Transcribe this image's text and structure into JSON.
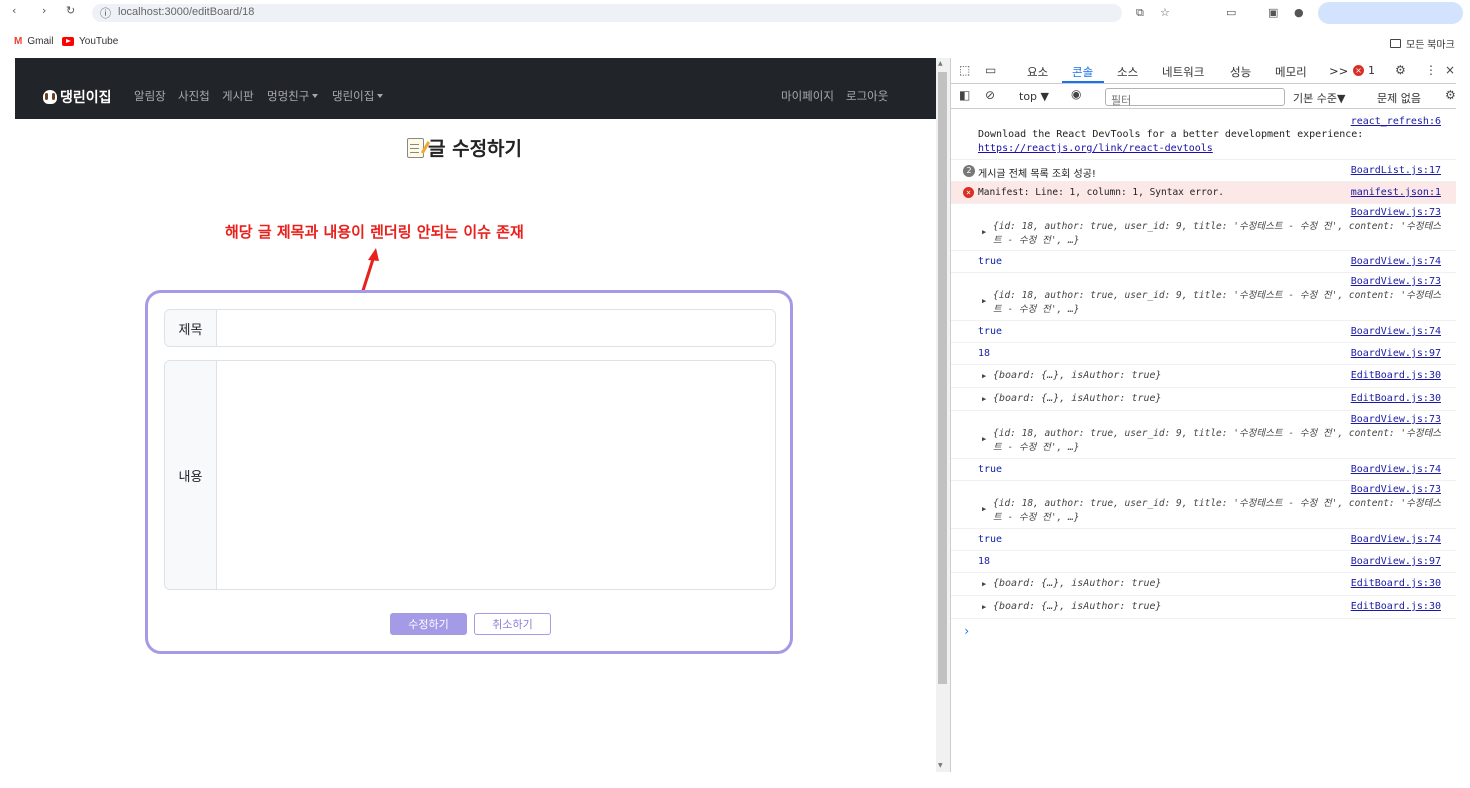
{
  "browser": {
    "url": "localhost:3000/editBoard/18",
    "bookmarks": [
      "Gmail",
      "YouTube"
    ],
    "bookmarks_right": "모든 북마크"
  },
  "navbar": {
    "brand": "댕린이집",
    "items": [
      {
        "label": "알림장"
      },
      {
        "label": "사진첩"
      },
      {
        "label": "게시판"
      },
      {
        "label": "멍멍친구",
        "dropdown": true
      },
      {
        "label": "댕린이집",
        "dropdown": true
      }
    ],
    "right_items": [
      "마이페이지",
      "로그아웃"
    ]
  },
  "page": {
    "title": "글 수정하기",
    "annotation": "해당 글 제목과 내용이 렌더링 안되는 이슈 존재",
    "annotation_color": "#e8211c",
    "form": {
      "title_label": "제목",
      "title_value": "",
      "content_label": "내용",
      "content_value": "",
      "submit_label": "수정하기",
      "cancel_label": "취소하기",
      "accent_color": "#a49ae6"
    }
  },
  "devtools": {
    "tabs": [
      "요소",
      "콘솔",
      "소스",
      "네트워크",
      "성능",
      "메모리"
    ],
    "active_tab": "콘솔",
    "more": ">>",
    "error_count": "1",
    "toolbar": {
      "context": "top",
      "filter_placeholder": "필터",
      "level": "기본 수준",
      "issues": "문제 없음"
    },
    "console": [
      {
        "type": "log",
        "text": "Download the React DevTools for a better development experience: ",
        "link": "https://reactjs.org/link/react-devtools",
        "source": "react_refresh:6"
      },
      {
        "type": "log",
        "count": "2",
        "text": "게시글 전체 목록 조회 성공!",
        "source": "BoardList.js:17"
      },
      {
        "type": "error",
        "text": "Manifest: Line: 1, column: 1, Syntax error.",
        "source": "manifest.json:1"
      },
      {
        "type": "object",
        "text": "{id: 18, author: true, user_id: 9, title: '수정테스트 - 수정 전', content: '수정테스트 - 수정 전', …}",
        "source": "BoardView.js:73"
      },
      {
        "type": "log",
        "text": "true",
        "source": "BoardView.js:74"
      },
      {
        "type": "object",
        "text": "{id: 18, author: true, user_id: 9, title: '수정테스트 - 수정 전', content: '수정테스트 - 수정 전', …}",
        "source": "BoardView.js:73"
      },
      {
        "type": "log",
        "text": "true",
        "source": "BoardView.js:74"
      },
      {
        "type": "log",
        "text": "18",
        "source": "BoardView.js:97"
      },
      {
        "type": "object",
        "text": "{board: {…}, isAuthor: true}",
        "source": "EditBoard.js:30"
      },
      {
        "type": "object",
        "text": "{board: {…}, isAuthor: true}",
        "source": "EditBoard.js:30"
      },
      {
        "type": "object",
        "text": "{id: 18, author: true, user_id: 9, title: '수정테스트 - 수정 전', content: '수정테스트 - 수정 전', …}",
        "source": "BoardView.js:73"
      },
      {
        "type": "log",
        "text": "true",
        "source": "BoardView.js:74"
      },
      {
        "type": "object",
        "text": "{id: 18, author: true, user_id: 9, title: '수정테스트 - 수정 전', content: '수정테스트 - 수정 전', …}",
        "source": "BoardView.js:73"
      },
      {
        "type": "log",
        "text": "true",
        "source": "BoardView.js:74"
      },
      {
        "type": "log",
        "text": "18",
        "source": "BoardView.js:97"
      },
      {
        "type": "object",
        "text": "{board: {…}, isAuthor: true}",
        "source": "EditBoard.js:30"
      },
      {
        "type": "object",
        "text": "{board: {…}, isAuthor: true}",
        "source": "EditBoard.js:30"
      }
    ]
  }
}
